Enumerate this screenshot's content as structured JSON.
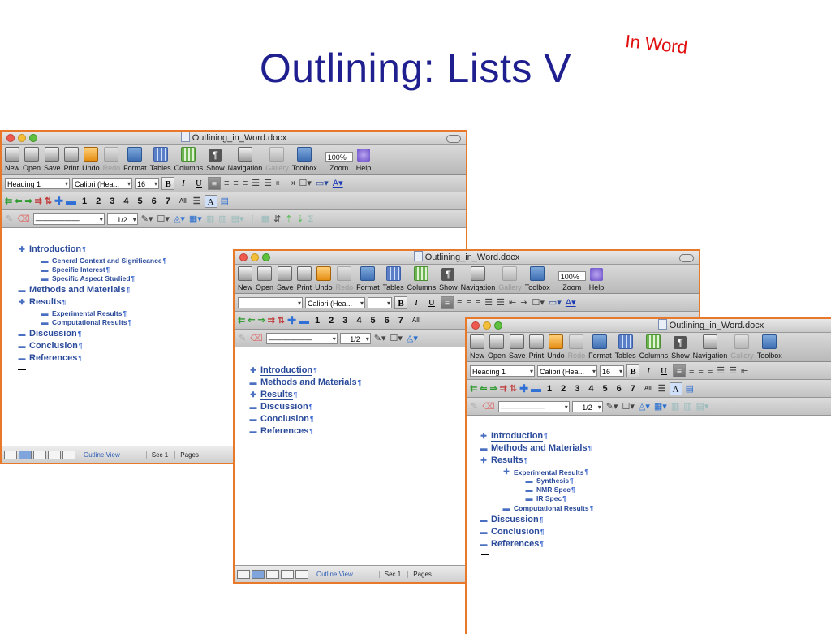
{
  "slide": {
    "title": "Outlining:  Lists V",
    "tag": "In Word"
  },
  "toolbar": {
    "items": [
      "New",
      "Open",
      "Save",
      "Print",
      "Undo",
      "Redo",
      "Format",
      "Tables",
      "Columns",
      "Show",
      "Navigation",
      "Gallery",
      "Toolbox",
      "Zoom",
      "Help"
    ],
    "zoom_value": "100%"
  },
  "formatting": {
    "style": "Heading 1",
    "font": "Calibri (Hea...",
    "size": "16",
    "bold": "B",
    "italic": "I",
    "underline": "U",
    "levels": [
      "1",
      "2",
      "3",
      "4",
      "5",
      "6",
      "7",
      "All"
    ],
    "line_ratio": "1/2"
  },
  "windows": [
    {
      "title": "Outlining_in_Word.docx",
      "style_value": "Heading 1",
      "size_value": "16",
      "outline": [
        {
          "text": "Introduction",
          "level": 1,
          "marker": "plus"
        },
        {
          "text": "General Context and Significance",
          "level": 2,
          "marker": "minus"
        },
        {
          "text": "Specific Interest",
          "level": 2,
          "marker": "minus"
        },
        {
          "text": "Specific Aspect Studied",
          "level": 2,
          "marker": "minus"
        },
        {
          "text": "Methods and Materials",
          "level": 1,
          "marker": "minus"
        },
        {
          "text": "Results",
          "level": 1,
          "marker": "plus"
        },
        {
          "text": "Experimental Results",
          "level": 2,
          "marker": "minus"
        },
        {
          "text": "Computational Results",
          "level": 2,
          "marker": "minus"
        },
        {
          "text": "Discussion",
          "level": 1,
          "marker": "minus"
        },
        {
          "text": "Conclusion",
          "level": 1,
          "marker": "minus"
        },
        {
          "text": "References",
          "level": 1,
          "marker": "minus"
        }
      ],
      "status": {
        "view": "Outline View",
        "sec_label": "Sec",
        "sec_value": "1",
        "pages_label": "Pages"
      }
    },
    {
      "title": "Outlining_in_Word.docx",
      "style_value": "",
      "size_value": "",
      "outline": [
        {
          "text": "Introduction",
          "level": 1,
          "marker": "plus"
        },
        {
          "text": "Methods and Materials",
          "level": 1,
          "marker": "minus"
        },
        {
          "text": "Results",
          "level": 1,
          "marker": "plus"
        },
        {
          "text": "Discussion",
          "level": 1,
          "marker": "minus"
        },
        {
          "text": "Conclusion",
          "level": 1,
          "marker": "minus"
        },
        {
          "text": "References",
          "level": 1,
          "marker": "minus"
        }
      ],
      "status": {
        "view": "Outline View",
        "sec_label": "Sec",
        "sec_value": "1",
        "pages_label": "Pages"
      }
    },
    {
      "title": "Outlining_in_Word.docx",
      "style_value": "Heading 1",
      "size_value": "16",
      "outline": [
        {
          "text": "Introduction",
          "level": 1,
          "marker": "plus"
        },
        {
          "text": "Methods and Materials",
          "level": 1,
          "marker": "minus"
        },
        {
          "text": "Results",
          "level": 1,
          "marker": "plus"
        },
        {
          "text": "Experimental Results",
          "level": 2,
          "marker": "plus"
        },
        {
          "text": "Synthesis",
          "level": 3,
          "marker": "minus"
        },
        {
          "text": "NMR Spec",
          "level": 3,
          "marker": "minus"
        },
        {
          "text": "IR Spec",
          "level": 3,
          "marker": "minus"
        },
        {
          "text": "Computational Results",
          "level": 2,
          "marker": "minus"
        },
        {
          "text": "Discussion",
          "level": 1,
          "marker": "minus"
        },
        {
          "text": "Conclusion",
          "level": 1,
          "marker": "minus"
        },
        {
          "text": "References",
          "level": 1,
          "marker": "minus"
        }
      ]
    }
  ]
}
